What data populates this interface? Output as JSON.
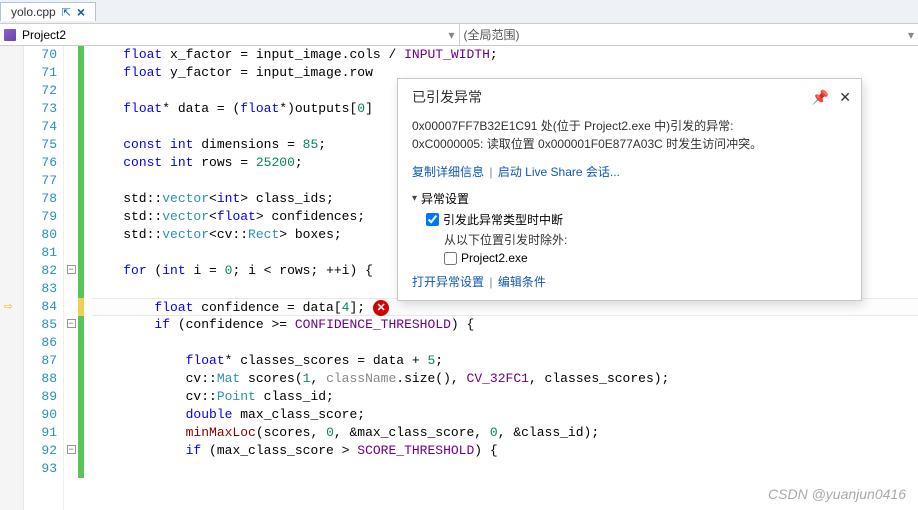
{
  "tab": {
    "name": "yolo.cpp",
    "pin": "⇱",
    "close": "×"
  },
  "nav": {
    "project": "Project2",
    "scope": "(全局范围)"
  },
  "line_start": 70,
  "current_line": 84,
  "lines": [
    {
      "n": 70,
      "mod": "g",
      "ind": 1,
      "html": "<span class='kw'>float</span> x_factor = input_image.<span class='nm'>cols</span> / <span class='mac'>INPUT_WIDTH</span>;"
    },
    {
      "n": 71,
      "mod": "g",
      "ind": 1,
      "html": "<span class='kw'>float</span> y_factor = input_image.<span class='nm'>row</span>"
    },
    {
      "n": 72,
      "mod": "g",
      "ind": 1,
      "html": ""
    },
    {
      "n": 73,
      "mod": "g",
      "ind": 1,
      "html": "<span class='kw'>float</span>* data = (<span class='kw'>float</span>*)outputs[<span class='num'>0</span>]"
    },
    {
      "n": 74,
      "mod": "g",
      "ind": 1,
      "html": ""
    },
    {
      "n": 75,
      "mod": "g",
      "ind": 1,
      "html": "<span class='kw'>const</span> <span class='kw'>int</span> dimensions = <span class='num'>85</span>;"
    },
    {
      "n": 76,
      "mod": "g",
      "ind": 1,
      "html": "<span class='kw'>const</span> <span class='kw'>int</span> rows = <span class='num'>25200</span>;"
    },
    {
      "n": 77,
      "mod": "g",
      "ind": 1,
      "html": ""
    },
    {
      "n": 78,
      "mod": "g",
      "ind": 1,
      "html": "std::<span class='typ'>vector</span>&lt;<span class='kw'>int</span>&gt; class_ids;"
    },
    {
      "n": 79,
      "mod": "g",
      "ind": 1,
      "html": "std::<span class='typ'>vector</span>&lt;<span class='kw'>float</span>&gt; confidences;"
    },
    {
      "n": 80,
      "mod": "g",
      "ind": 1,
      "html": "std::<span class='typ'>vector</span>&lt;cv::<span class='typ'>Rect</span>&gt; boxes;"
    },
    {
      "n": 81,
      "mod": "g",
      "ind": 1,
      "html": ""
    },
    {
      "n": 82,
      "mod": "g",
      "ind": 1,
      "fold": "-",
      "html": "<span class='kw'>for</span> (<span class='kw'>int</span> i = <span class='num'>0</span>; i &lt; rows; ++i) {"
    },
    {
      "n": 83,
      "mod": "g",
      "ind": 1,
      "html": ""
    },
    {
      "n": 84,
      "mod": "y",
      "ind": 2,
      "hl": true,
      "err": true,
      "html": "<span class='kw'>float</span> confidence = data[<span class='num'>4</span>];"
    },
    {
      "n": 85,
      "mod": "g",
      "ind": 2,
      "fold": "-",
      "html": "<span class='kw'>if</span> (confidence &gt;= <span class='mac'>CONFIDENCE_THRESHOLD</span>) {"
    },
    {
      "n": 86,
      "mod": "g",
      "ind": 2,
      "html": ""
    },
    {
      "n": 87,
      "mod": "g",
      "ind": 3,
      "html": "<span class='kw'>float</span>* classes_scores = data + <span class='num'>5</span>;"
    },
    {
      "n": 88,
      "mod": "g",
      "ind": 3,
      "html": "cv::<span class='typ'>Mat</span> scores(<span class='num'>1</span>, <span class='var'>className</span>.size(), <span class='mac'>CV_32FC1</span>, classes_scores);"
    },
    {
      "n": 89,
      "mod": "g",
      "ind": 3,
      "html": "cv::<span class='typ'>Point</span> class_id;"
    },
    {
      "n": 90,
      "mod": "g",
      "ind": 3,
      "html": "<span class='kw'>double</span> max_class_score;"
    },
    {
      "n": 91,
      "mod": "g",
      "ind": 3,
      "html": "<span class='fn'>minMaxLoc</span>(scores, <span class='num'>0</span>, &amp;max_class_score, <span class='num'>0</span>, &amp;class_id);"
    },
    {
      "n": 92,
      "mod": "g",
      "ind": 3,
      "fold": "-",
      "html": "<span class='kw'>if</span> (max_class_score &gt; <span class='mac'>SCORE_THRESHOLD</span>) {"
    },
    {
      "n": 93,
      "mod": "g",
      "ind": 3,
      "html": ""
    }
  ],
  "popup": {
    "title": "已引发异常",
    "message1": "0x00007FF7B32E1C91 处(位于 Project2.exe 中)引发的异常:",
    "message2": "0xC0000005: 读取位置 0x000001F0E877A03C 时发生访问冲突。",
    "link_copy": "复制详细信息",
    "link_liveshare": "启动 Live Share 会话...",
    "section_title": "异常设置",
    "check1_label": "引发此异常类型时中断",
    "sub_label": "从以下位置引发时除外:",
    "check2_label": "Project2.exe",
    "link_open": "打开异常设置",
    "link_edit": "编辑条件",
    "pin": "📌",
    "close": "✕"
  },
  "watermark": "CSDN @yuanjun0416"
}
